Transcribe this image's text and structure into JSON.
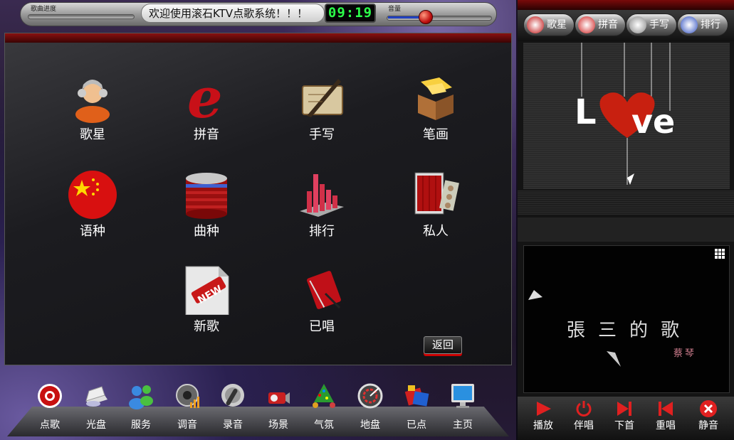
{
  "topbar": {
    "progress_label": "歌曲进度",
    "marquee_text": "欢迎使用滚石KTV点歌系统！！！",
    "clock": "09:19",
    "volume_label": "音量",
    "volume_level": 0.55
  },
  "grid": {
    "items": [
      {
        "label": "歌星",
        "icon": "singer-icon"
      },
      {
        "label": "拼音",
        "icon": "pinyin-e-icon"
      },
      {
        "label": "手写",
        "icon": "handwriting-quill-icon"
      },
      {
        "label": "笔画",
        "icon": "stroke-box-icon"
      },
      {
        "label": "语种",
        "icon": "china-flag-icon"
      },
      {
        "label": "曲种",
        "icon": "database-stack-icon"
      },
      {
        "label": "排行",
        "icon": "ranking-chart-icon"
      },
      {
        "label": "私人",
        "icon": "private-curtain-icon"
      },
      {
        "label": "新歌",
        "icon": "new-badge-icon"
      },
      {
        "label": "已唱",
        "icon": "sung-notebook-icon"
      }
    ],
    "back_label": "返回"
  },
  "dock": {
    "items": [
      {
        "label": "点歌",
        "icon": "order-disc-icon"
      },
      {
        "label": "光盘",
        "icon": "cd-drive-icon"
      },
      {
        "label": "服务",
        "icon": "service-users-icon"
      },
      {
        "label": "调音",
        "icon": "tuning-speaker-icon"
      },
      {
        "label": "录音",
        "icon": "record-mic-icon"
      },
      {
        "label": "场景",
        "icon": "scene-camera-icon"
      },
      {
        "label": "气氛",
        "icon": "atmosphere-tree-icon"
      },
      {
        "label": "地盘",
        "icon": "territory-dial-icon"
      },
      {
        "label": "已点",
        "icon": "ordered-film-icon"
      },
      {
        "label": "主页",
        "icon": "home-monitor-icon"
      }
    ]
  },
  "right_tabs": [
    {
      "label": "歌星",
      "icon": "singer-tab-icon",
      "color": "#c01010"
    },
    {
      "label": "拼音",
      "icon": "pinyin-tab-icon",
      "color": "#d02020"
    },
    {
      "label": "手写",
      "icon": "handwriting-tab-icon",
      "color": "#888888"
    },
    {
      "label": "排行",
      "icon": "ranking-tab-icon",
      "color": "#3050c0"
    }
  ],
  "banner": {
    "text_left": "L",
    "text_right": "ve"
  },
  "video": {
    "title": "張三的歌",
    "subtitle": "蔡琴"
  },
  "controls": [
    {
      "label": "播放",
      "icon": "play-icon"
    },
    {
      "label": "伴唱",
      "icon": "power-icon"
    },
    {
      "label": "下首",
      "icon": "next-track-icon"
    },
    {
      "label": "重唱",
      "icon": "replay-icon"
    },
    {
      "label": "静音",
      "icon": "mute-icon"
    }
  ],
  "colors": {
    "accent": "#cc1010",
    "clock_digits": "#2dff4a"
  }
}
